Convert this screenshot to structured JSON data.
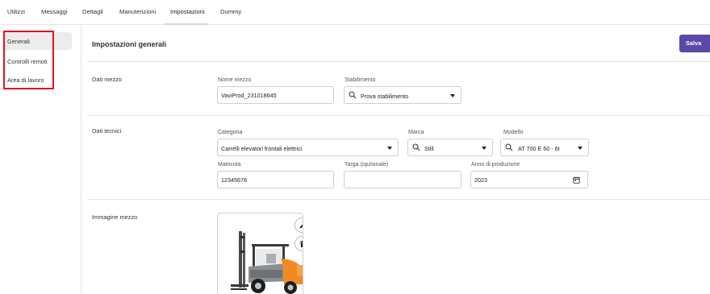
{
  "tabs": [
    {
      "label": "Utilizzi"
    },
    {
      "label": "Messaggi"
    },
    {
      "label": "Dettagli"
    },
    {
      "label": "Manutenzioni"
    },
    {
      "label": "Impostazioni",
      "active": true
    },
    {
      "label": "Dummy"
    }
  ],
  "sidebar": {
    "items": [
      {
        "label": "Generali",
        "active": true
      },
      {
        "label": "Controlli remoti"
      },
      {
        "label": "Area di lavoro"
      }
    ]
  },
  "header": {
    "title": "Impostazioni generali",
    "save_label": "Salva"
  },
  "dati_mezzo": {
    "label": "Dati mezzo",
    "nome_mezzo": {
      "label": "Nome mezzo",
      "value": "VaviProd_231018645"
    },
    "stabilimento": {
      "label": "Stabilimento",
      "value": "Prova stabilimento"
    }
  },
  "dati_tecnici": {
    "label": "Dati tecnici",
    "categoria": {
      "label": "Categoria",
      "value": "Carrelli elevatori frontali elettrici"
    },
    "marca": {
      "label": "Marca",
      "value": "Still"
    },
    "modello": {
      "label": "Modello",
      "value": "AT 700 E 60 - 6t"
    },
    "matricola": {
      "label": "Matricola",
      "value": "12345678"
    },
    "targa": {
      "label": "Targa (opzionale)",
      "value": ""
    },
    "anno": {
      "label": "Anno di produzione",
      "value": "2023"
    }
  },
  "immagine": {
    "label": "Immagine mezzo"
  },
  "colors": {
    "accent": "#5b48a8",
    "highlight_box": "#e0141e",
    "forklift_orange": "#f08a24"
  },
  "icons": [
    "search-icon",
    "chevron-down-icon",
    "calendar-icon",
    "pencil-icon",
    "trash-icon"
  ]
}
